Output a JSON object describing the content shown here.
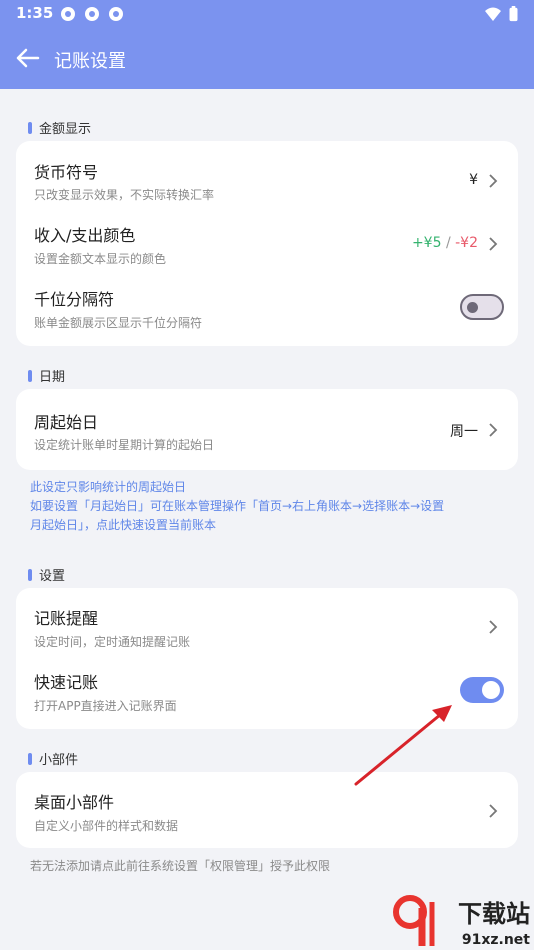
{
  "status_bar": {
    "time": "1:35"
  },
  "app_bar": {
    "title": "记账设置"
  },
  "sections": {
    "amount": {
      "title": "金额显示",
      "currency": {
        "title": "货币符号",
        "subtitle": "只改变显示效果，不实际转换汇率",
        "value": "¥"
      },
      "color": {
        "title": "收入/支出颜色",
        "subtitle": "设置金额文本显示的颜色",
        "income": "+¥5",
        "separator": "/",
        "expense": "-¥2"
      },
      "thousands": {
        "title": "千位分隔符",
        "subtitle": "账单金额展示区显示千位分隔符",
        "enabled": false
      }
    },
    "date": {
      "title": "日期",
      "week_start": {
        "title": "周起始日",
        "subtitle": "设定统计账单时星期计算的起始日",
        "value": "周一"
      },
      "note_line1": "此设定只影响统计的周起始日",
      "note_line2": "如要设置「月起始日」可在账本管理操作「首页→右上角账本→选择账本→设置",
      "note_line3": "月起始日」，点此快速设置当前账本"
    },
    "settings": {
      "title": "设置",
      "reminder": {
        "title": "记账提醒",
        "subtitle": "设定时间，定时通知提醒记账"
      },
      "quick": {
        "title": "快速记账",
        "subtitle": "打开APP直接进入记账界面",
        "enabled": true
      }
    },
    "widget": {
      "title": "小部件",
      "desktop": {
        "title": "桌面小部件",
        "subtitle": "自定义小部件的样式和数据"
      },
      "note": "若无法添加请点此前往系统设置「权限管理」授予此权限"
    }
  },
  "watermark": {
    "text": "下载站",
    "url": "91xz.net"
  },
  "colors": {
    "header": "#7b93ef",
    "accent": "#6f8cf0",
    "income": "#35b36f",
    "expense": "#e85a6a"
  }
}
